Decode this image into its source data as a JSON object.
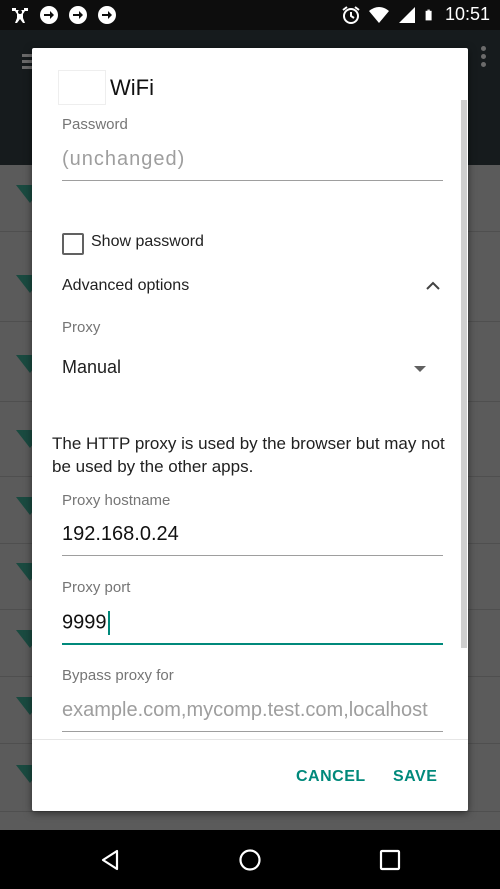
{
  "status_bar": {
    "left_icons": [
      "fitness-icon",
      "arrow-circle-icon",
      "arrow-circle-icon",
      "arrow-circle-icon"
    ],
    "right_icons": [
      "alarm-icon",
      "wifi-icon",
      "signal-icon",
      "battery-icon"
    ],
    "time": "10:51"
  },
  "dialog": {
    "title": "WiFi",
    "password": {
      "label": "Password",
      "placeholder": "(unchanged)",
      "value": ""
    },
    "show_password": {
      "label": "Show password",
      "checked": false
    },
    "advanced_options": {
      "label": "Advanced options",
      "expanded": true
    },
    "proxy": {
      "label": "Proxy",
      "selected": "Manual"
    },
    "info_text": "The HTTP proxy is used by the browser but may not be used by the other apps.",
    "proxy_hostname": {
      "label": "Proxy hostname",
      "value": "192.168.0.24"
    },
    "proxy_port": {
      "label": "Proxy port",
      "value": "9999"
    },
    "bypass_proxy": {
      "label": "Bypass proxy for",
      "placeholder": "example.com,mycomp.test.com,localhost"
    },
    "buttons": {
      "cancel": "CANCEL",
      "save": "SAVE"
    },
    "accent_color": "#00897b"
  },
  "nav_bar": {
    "icons": [
      "back-icon",
      "home-icon",
      "recents-icon"
    ]
  }
}
